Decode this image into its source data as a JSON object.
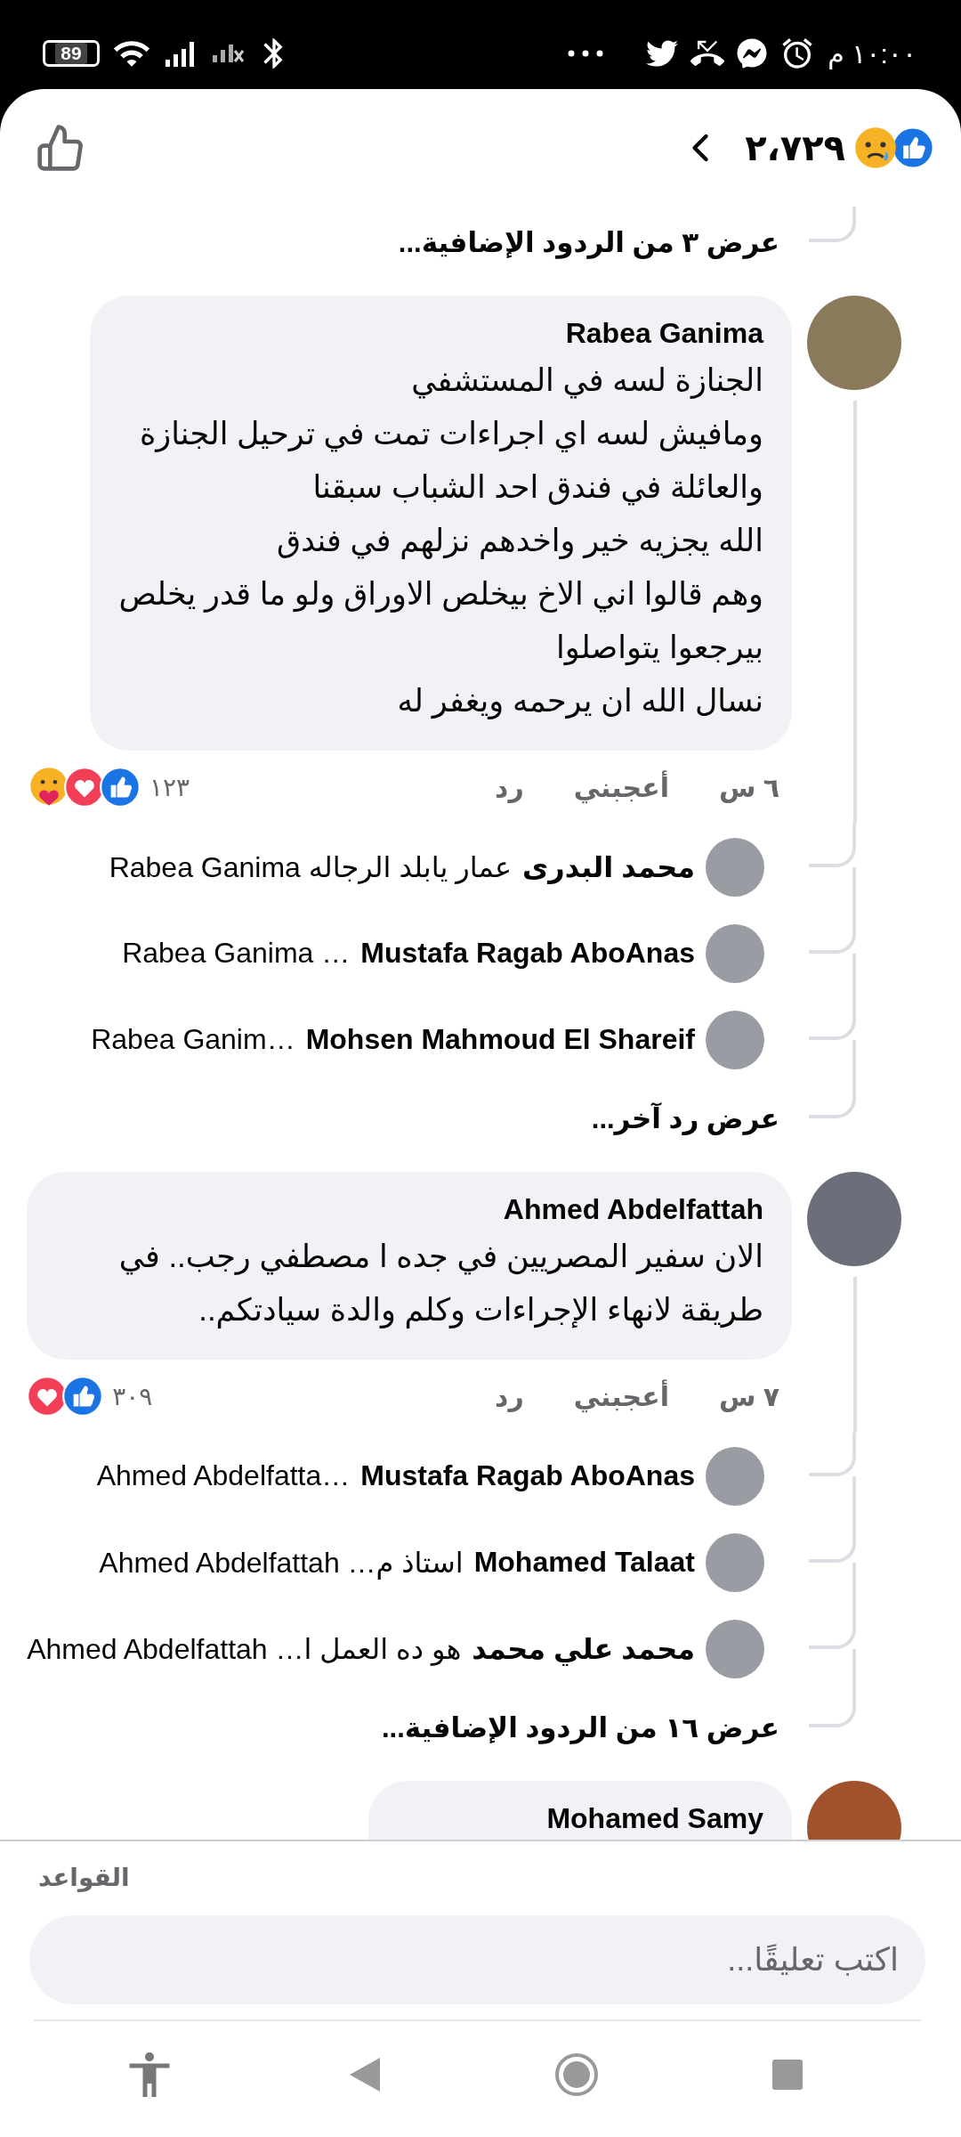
{
  "status_bar": {
    "time": "١٠:٠٠ م",
    "battery": "89"
  },
  "header": {
    "reactions": [
      {
        "kind": "like"
      },
      {
        "kind": "sad"
      }
    ],
    "count": "٢،٧٢٩"
  },
  "thread_end": {
    "more_replies": "عرض ٣ من الردود الإضافية..."
  },
  "comments": [
    {
      "author": "Rabea Ganima",
      "text": "الجنازة لسه في المستشفي\nومافيش لسه اي اجراءات تمت في ترحيل الجنازة\nوالعائلة في فندق احد الشباب سبقنا\nالله يجزيه خير واخدهم نزلهم في فندق\nوهم قالوا اني الاخ بيخلص الاوراق ولو ما قدر يخلص\nبيرجعوا يتواصلوا\nنسال الله ان يرحمه ويغفر له",
      "time": "٦ س",
      "like": "أعجبني",
      "reply": "رد",
      "reactions": [
        {
          "kind": "care"
        },
        {
          "kind": "love"
        },
        {
          "kind": "like"
        }
      ],
      "reaction_count": "١٢٣",
      "replies": [
        {
          "author": "محمد البدرى",
          "text": "عمار يابلد الرجاله Rabea Ganima"
        },
        {
          "author": "Mustafa Ragab AboAnas",
          "text": "Rabea Ganima …"
        },
        {
          "author": "Mohsen Mahmoud El Shareif",
          "text": "Rabea Ganim…"
        }
      ],
      "more_replies": "عرض رد آخر..."
    },
    {
      "author": "Ahmed Abdelfattah",
      "text": "الان سفير المصريين في جده ا مصطفي رجب.. في طريقة لانهاء الإجراءات وكلم والدة سيادتكم..",
      "time": "٧ س",
      "like": "أعجبني",
      "reply": "رد",
      "reactions": [
        {
          "kind": "love"
        },
        {
          "kind": "like"
        }
      ],
      "reaction_count": "٣٠٩",
      "replies": [
        {
          "author": "Mustafa Ragab AboAnas",
          "text": "Ahmed Abdelfatta…"
        },
        {
          "author": "Mohamed Talaat",
          "text": "استاذ م… Ahmed Abdelfattah"
        },
        {
          "author": "محمد علي محمد",
          "text": "هو ده العمل ا… Ahmed Abdelfattah"
        }
      ],
      "more_replies": "عرض ١٦ من الردود الإضافية..."
    }
  ],
  "partial_comment": {
    "author": "Mohamed Samy"
  },
  "composer": {
    "rules": "القواعد",
    "placeholder": "اكتب تعليقًا..."
  }
}
